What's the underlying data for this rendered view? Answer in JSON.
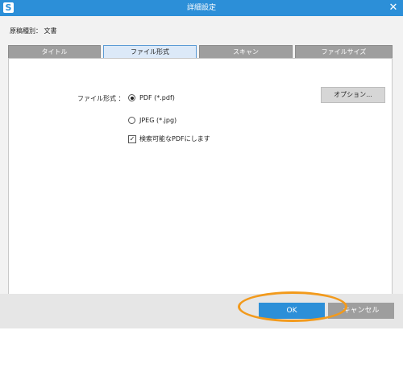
{
  "window": {
    "title": "詳細設定",
    "app_icon": "S",
    "close_glyph": "✕"
  },
  "doc_type": "原稿種別： 文書",
  "tabs": [
    {
      "label": "タイトル",
      "active": false
    },
    {
      "label": "ファイル形式",
      "active": true
    },
    {
      "label": "スキャン",
      "active": false
    },
    {
      "label": "ファイルサイズ",
      "active": false
    }
  ],
  "file_format": {
    "label": "ファイル形式 ：",
    "options": [
      {
        "label": "PDF (*.pdf)",
        "selected": true
      },
      {
        "label": "JPEG (*.jpg)",
        "selected": false
      }
    ],
    "searchable_pdf": {
      "label": "検索可能なPDFにします",
      "checked": true
    },
    "options_button": "オプション..."
  },
  "footer": {
    "ok": "OK",
    "cancel": "キャンセル"
  },
  "colors": {
    "accent": "#2c8fd8",
    "highlight": "#f29a1c",
    "tab_inactive": "#9e9e9e"
  }
}
